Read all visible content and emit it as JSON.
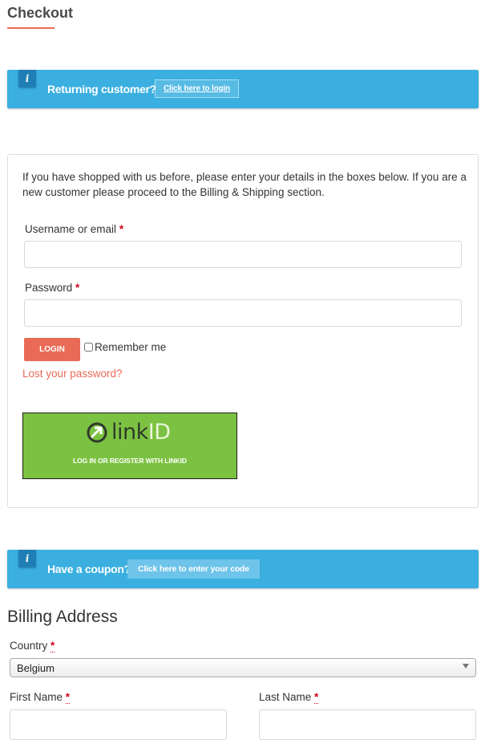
{
  "page": {
    "title": "Checkout"
  },
  "returning_notice": {
    "text": "Returning customer?",
    "link_label": "Click here to login",
    "badge": "i"
  },
  "login": {
    "intro": "If you have shopped with us before, please enter your details in the boxes below. If you are a new customer please proceed to the Billing & Shipping section.",
    "username_label": "Username or email",
    "password_label": "Password",
    "required_mark": "*",
    "username_value": "",
    "password_value": "",
    "login_button": "LOGIN",
    "remember_label": "Remember me",
    "remember_checked": false,
    "lost_password": "Lost your password?",
    "linkid_wordmark_link": "link",
    "linkid_wordmark_id": "ID",
    "linkid_caption": "LOG IN OR REGISTER WITH LINKID"
  },
  "coupon_notice": {
    "text": "Have a coupon?",
    "link_label": "Click here to enter your code",
    "badge": "i"
  },
  "billing": {
    "title": "Billing Address",
    "country_label": "Country",
    "country_value": "Belgium",
    "first_name_label": "First Name",
    "last_name_label": "Last Name",
    "first_name_value": "",
    "last_name_value": "",
    "required_mark": "*"
  },
  "colors": {
    "accent": "#e96b56",
    "notice_blue": "#3aafe0",
    "linkid_green": "#7cc242"
  }
}
